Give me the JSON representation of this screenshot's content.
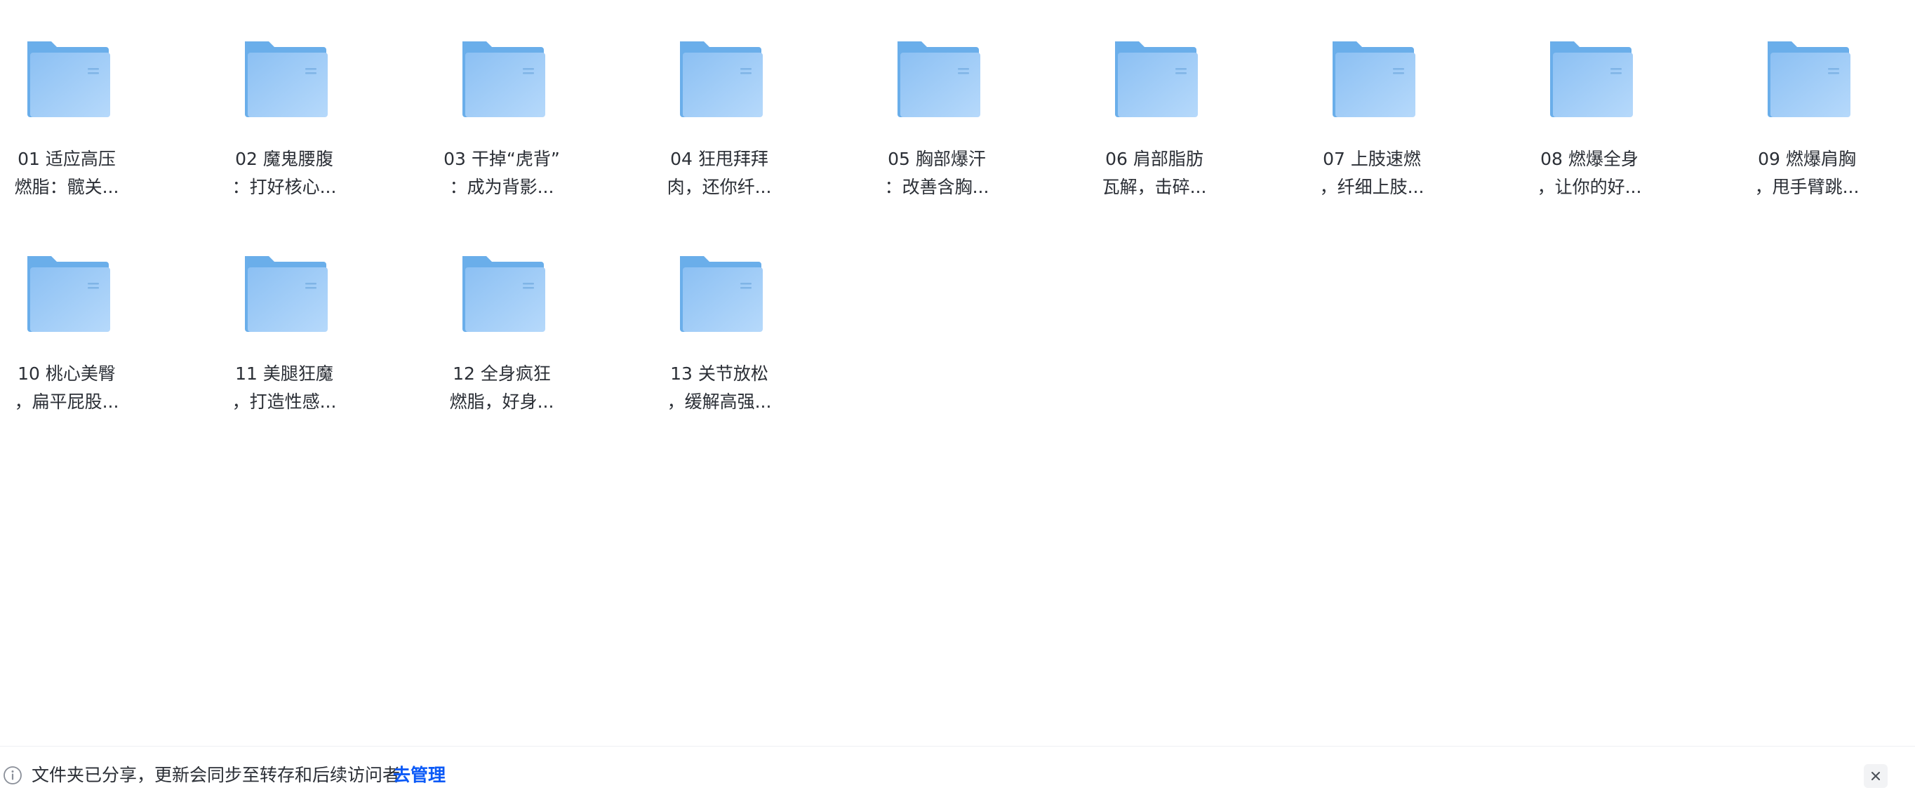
{
  "folders": [
    {
      "line1": "01 适应高压",
      "line2": "燃脂：髋关..."
    },
    {
      "line1": "02 魔鬼腰腹",
      "line2": "：打好核心..."
    },
    {
      "line1": "03 干掉“虎背”",
      "line2": "：成为背影..."
    },
    {
      "line1": "04 狂甩拜拜",
      "line2": "肉，还你纤..."
    },
    {
      "line1": "05 胸部爆汗",
      "line2": "：改善含胸..."
    },
    {
      "line1": "06 肩部脂肪",
      "line2": "瓦解，击碎..."
    },
    {
      "line1": "07 上肢速燃",
      "line2": "，纤细上肢..."
    },
    {
      "line1": "08 燃爆全身",
      "line2": "，让你的好..."
    },
    {
      "line1": "09 燃爆肩胸",
      "line2": "，甩手臂跳..."
    },
    {
      "line1": "10 桃心美臀",
      "line2": "，扁平屁股..."
    },
    {
      "line1": "11 美腿狂魔",
      "line2": "，打造性感..."
    },
    {
      "line1": "12 全身疯狂",
      "line2": "燃脂，好身..."
    },
    {
      "line1": "13 关节放松",
      "line2": "，缓解高强..."
    }
  ],
  "footer": {
    "icon": "info-icon",
    "message": "文件夹已分享，更新会同步至转存和后续访问者",
    "manage_label": "去管理",
    "close_icon": "close-icon"
  },
  "colors": {
    "link": "#0a59f7",
    "folder_front": "#9fcaf6",
    "folder_back": "#6aaeea"
  }
}
